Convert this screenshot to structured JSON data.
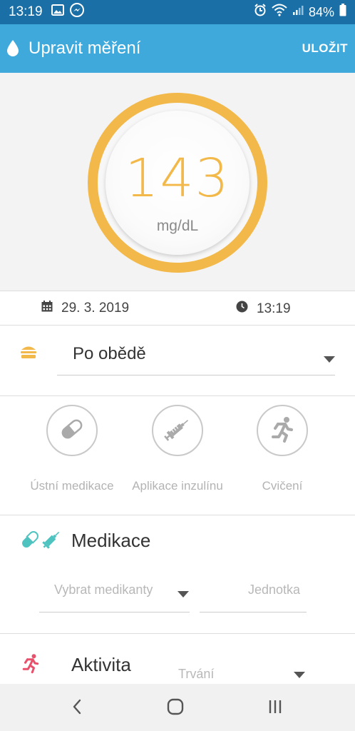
{
  "status_bar": {
    "time": "13:19",
    "battery": "84%",
    "left_icons": [
      "image-icon",
      "messenger-icon"
    ],
    "right_icons": [
      "alarm-icon",
      "wifi-icon",
      "signal-icon",
      "battery-icon"
    ]
  },
  "app_bar": {
    "title": "Upravit měření",
    "save_label": "ULOŽIT",
    "icon": "blood-drop-icon"
  },
  "reading": {
    "value": "143",
    "unit": "mg/dL",
    "ring_color": "#f2b94a"
  },
  "datetime": {
    "date": "29. 3. 2019",
    "time": "13:19"
  },
  "meal": {
    "selected": "Po obědě",
    "icon": "meal-burger-icon"
  },
  "quick_actions": [
    {
      "label": "Ústní medikace",
      "icon": "pill-icon"
    },
    {
      "label": "Aplikace inzulínu",
      "icon": "syringe-icon"
    },
    {
      "label": "Cvičení",
      "icon": "running-icon"
    }
  ],
  "medication": {
    "title": "Medikace",
    "picker_placeholder": "Vybrat medikanty",
    "unit_placeholder": "Jednotka"
  },
  "activity": {
    "title": "Aktivita",
    "duration_placeholder": "Trvání"
  },
  "colors": {
    "status_bar": "#1a6fa6",
    "app_bar": "#3fa9dc",
    "accent_orange": "#f2b94a",
    "medication_teal": "#4fc3c0",
    "activity_pink": "#e8506b"
  }
}
